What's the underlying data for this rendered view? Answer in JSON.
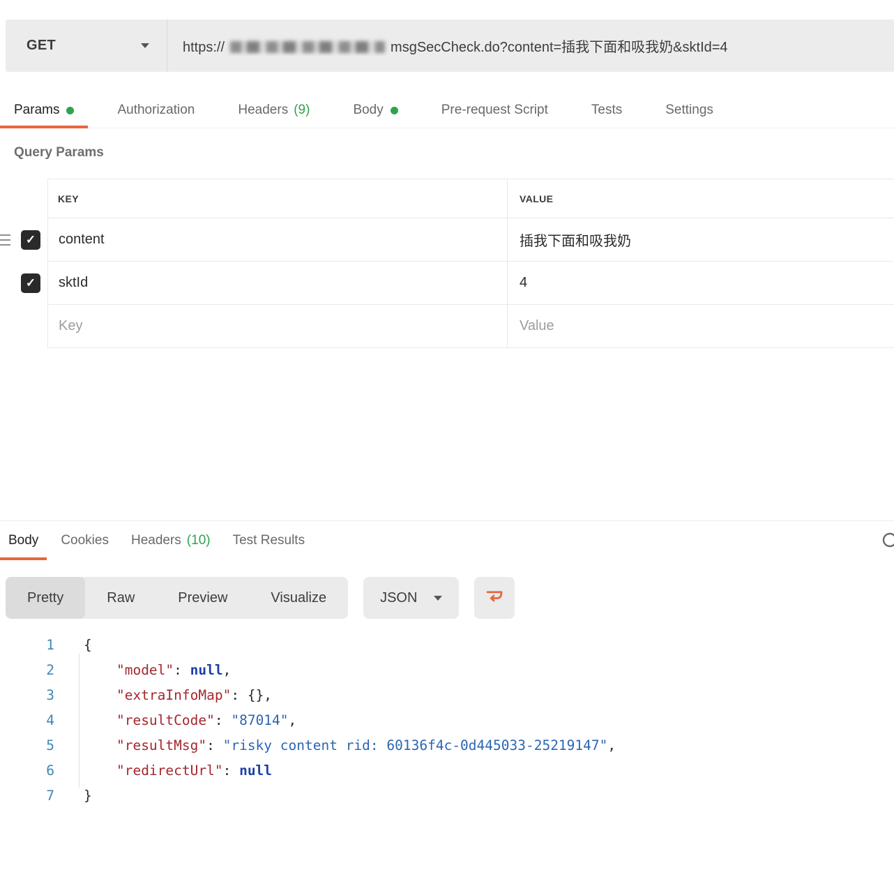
{
  "theme": {
    "accent_orange": "#e8663d",
    "accent_green": "#2da44e",
    "syntax": {
      "key": "#a5272d",
      "string": "#2a66b2",
      "keyword": "#1c3faa",
      "line_number": "#3f87b5"
    }
  },
  "request": {
    "method": "GET",
    "url": {
      "prefix": "https://",
      "suffix": "msgSecCheck.do?content=插我下面和吸我奶&sktId=4"
    },
    "tabs": [
      {
        "label": "Params",
        "active": true,
        "dot": true
      },
      {
        "label": "Authorization"
      },
      {
        "label": "Headers",
        "count": "(9)"
      },
      {
        "label": "Body",
        "dot": true
      },
      {
        "label": "Pre-request Script"
      },
      {
        "label": "Tests"
      },
      {
        "label": "Settings"
      }
    ]
  },
  "params": {
    "title": "Query Params",
    "columns": [
      "KEY",
      "VALUE"
    ],
    "rows": [
      {
        "key": "content",
        "value": "插我下面和吸我奶",
        "checked": true,
        "drag": true
      },
      {
        "key": "sktId",
        "value": "4",
        "checked": true
      }
    ],
    "placeholder": {
      "key": "Key",
      "value": "Value"
    }
  },
  "response": {
    "tabs": [
      {
        "label": "Body",
        "active": true
      },
      {
        "label": "Cookies"
      },
      {
        "label": "Headers",
        "count": "(10)"
      },
      {
        "label": "Test Results"
      }
    ],
    "views": [
      {
        "label": "Pretty",
        "active": true
      },
      {
        "label": "Raw"
      },
      {
        "label": "Preview"
      },
      {
        "label": "Visualize"
      }
    ],
    "language": "JSON",
    "code": [
      {
        "line": 1,
        "tokens": [
          {
            "c": "p",
            "v": "{"
          }
        ]
      },
      {
        "line": 2,
        "tokens": [
          {
            "c": "p",
            "v": "    "
          },
          {
            "c": "k",
            "v": "\"model\""
          },
          {
            "c": "p",
            "v": ": "
          },
          {
            "c": "n",
            "v": "null"
          },
          {
            "c": "p",
            "v": ","
          }
        ]
      },
      {
        "line": 3,
        "tokens": [
          {
            "c": "p",
            "v": "    "
          },
          {
            "c": "k",
            "v": "\"extraInfoMap\""
          },
          {
            "c": "p",
            "v": ": {},"
          }
        ]
      },
      {
        "line": 4,
        "tokens": [
          {
            "c": "p",
            "v": "    "
          },
          {
            "c": "k",
            "v": "\"resultCode\""
          },
          {
            "c": "p",
            "v": ": "
          },
          {
            "c": "s",
            "v": "\"87014\""
          },
          {
            "c": "p",
            "v": ","
          }
        ]
      },
      {
        "line": 5,
        "tokens": [
          {
            "c": "p",
            "v": "    "
          },
          {
            "c": "k",
            "v": "\"resultMsg\""
          },
          {
            "c": "p",
            "v": ": "
          },
          {
            "c": "s",
            "v": "\"risky content rid: 60136f4c-0d445033-25219147\""
          },
          {
            "c": "p",
            "v": ","
          }
        ]
      },
      {
        "line": 6,
        "tokens": [
          {
            "c": "p",
            "v": "    "
          },
          {
            "c": "k",
            "v": "\"redirectUrl\""
          },
          {
            "c": "p",
            "v": ": "
          },
          {
            "c": "n",
            "v": "null"
          }
        ]
      },
      {
        "line": 7,
        "tokens": [
          {
            "c": "p",
            "v": "}"
          }
        ]
      }
    ]
  }
}
